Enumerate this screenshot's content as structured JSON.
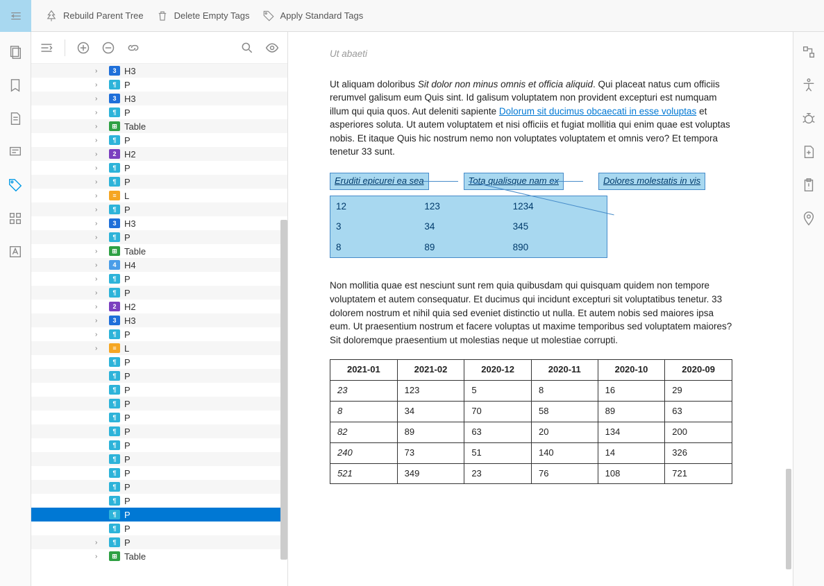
{
  "toolbar": {
    "rebuild": "Rebuild Parent Tree",
    "delete": "Delete Empty Tags",
    "apply": "Apply Standard Tags"
  },
  "tree": [
    {
      "t": "H3",
      "l": "H3",
      "c": true
    },
    {
      "t": "P",
      "l": "P",
      "c": true
    },
    {
      "t": "H3",
      "l": "H3",
      "c": true
    },
    {
      "t": "P",
      "l": "P",
      "c": true
    },
    {
      "t": "Table",
      "l": "Table",
      "c": true
    },
    {
      "t": "P",
      "l": "P",
      "c": true
    },
    {
      "t": "H2",
      "l": "H2",
      "c": true
    },
    {
      "t": "P",
      "l": "P",
      "c": true
    },
    {
      "t": "P",
      "l": "P",
      "c": true
    },
    {
      "t": "L",
      "l": "L",
      "c": true
    },
    {
      "t": "P",
      "l": "P",
      "c": true
    },
    {
      "t": "H3",
      "l": "H3",
      "c": true
    },
    {
      "t": "P",
      "l": "P",
      "c": true
    },
    {
      "t": "Table",
      "l": "Table",
      "c": true
    },
    {
      "t": "H4",
      "l": "H4",
      "c": true
    },
    {
      "t": "P",
      "l": "P",
      "c": true
    },
    {
      "t": "P",
      "l": "P",
      "c": true
    },
    {
      "t": "H2",
      "l": "H2",
      "c": true
    },
    {
      "t": "H3",
      "l": "H3",
      "c": true
    },
    {
      "t": "P",
      "l": "P",
      "c": true
    },
    {
      "t": "L",
      "l": "L",
      "c": true
    },
    {
      "t": "P",
      "l": "P",
      "c": false
    },
    {
      "t": "P",
      "l": "P",
      "c": false
    },
    {
      "t": "P",
      "l": "P",
      "c": false
    },
    {
      "t": "P",
      "l": "P",
      "c": false
    },
    {
      "t": "P",
      "l": "P",
      "c": false
    },
    {
      "t": "P",
      "l": "P",
      "c": false
    },
    {
      "t": "P",
      "l": "P",
      "c": false
    },
    {
      "t": "P",
      "l": "P",
      "c": false
    },
    {
      "t": "P",
      "l": "P",
      "c": false
    },
    {
      "t": "P",
      "l": "P",
      "c": false
    },
    {
      "t": "P",
      "l": "P",
      "c": false
    },
    {
      "t": "P",
      "l": "P",
      "c": false,
      "sel": true
    },
    {
      "t": "P",
      "l": "P",
      "c": false
    },
    {
      "t": "P",
      "l": "P",
      "c": true
    },
    {
      "t": "Table",
      "l": "Table",
      "c": true
    }
  ],
  "doc": {
    "caption": "Ut abaeti",
    "p1_a": "Ut aliquam doloribus ",
    "p1_em": "Sit dolor non minus omnis et officia aliquid",
    "p1_b": ". Qui placeat natus cum officiis rerumvel galisum eum Quis sint. Id galisum voluptatem non provident excepturi est numquam illum qui quia quos. Aut deleniti sapiente ",
    "p1_link": "Dolorum sit ducimus obcaecati in esse voluptas",
    "p1_c": " et asperiores soluta. Ut autem voluptatem et nisi officiis et fugiat mollitia qui enim quae est voluptas nobis. Et itaque Quis hic nostrum nemo non voluptates voluptatem et omnis vero? Et tempora tenetur 33 sunt.",
    "sel_h": [
      "Eruditi epicurei ea sea",
      "Tota qualisque nam ex",
      "Dolores molestatis in vis"
    ],
    "sel_rows": [
      [
        "12",
        "123",
        "1234"
      ],
      [
        "3",
        "34",
        "345"
      ],
      [
        "8",
        "89",
        "890"
      ]
    ],
    "p2": "Non mollitia quae est nesciunt sunt rem quia quibusdam qui quisquam quidem non tempore voluptatem et autem consequatur. Et ducimus qui incidunt excepturi sit voluptatibus tenetur. 33 dolorem nostrum et nihil quia sed eveniet distinctio ut nulla. Et autem nobis sed maiores ipsa eum. Ut praesentium nostrum et facere voluptas ut maxime temporibus sed voluptatem maiores? Sit doloremque praesentium ut molestias neque ut molestiae corrupti.",
    "table_headers": [
      "2021-01",
      "2021-02",
      "2020-12",
      "2020-11",
      "2020-10",
      "2020-09"
    ],
    "table_rows": [
      [
        "23",
        "123",
        "5",
        "8",
        "16",
        "29"
      ],
      [
        "8",
        "34",
        "70",
        "58",
        "89",
        "63"
      ],
      [
        "82",
        "89",
        "63",
        "20",
        "134",
        "200"
      ],
      [
        "240",
        "73",
        "51",
        "140",
        "14",
        "326"
      ],
      [
        "521",
        "349",
        "23",
        "76",
        "108",
        "721"
      ]
    ]
  }
}
